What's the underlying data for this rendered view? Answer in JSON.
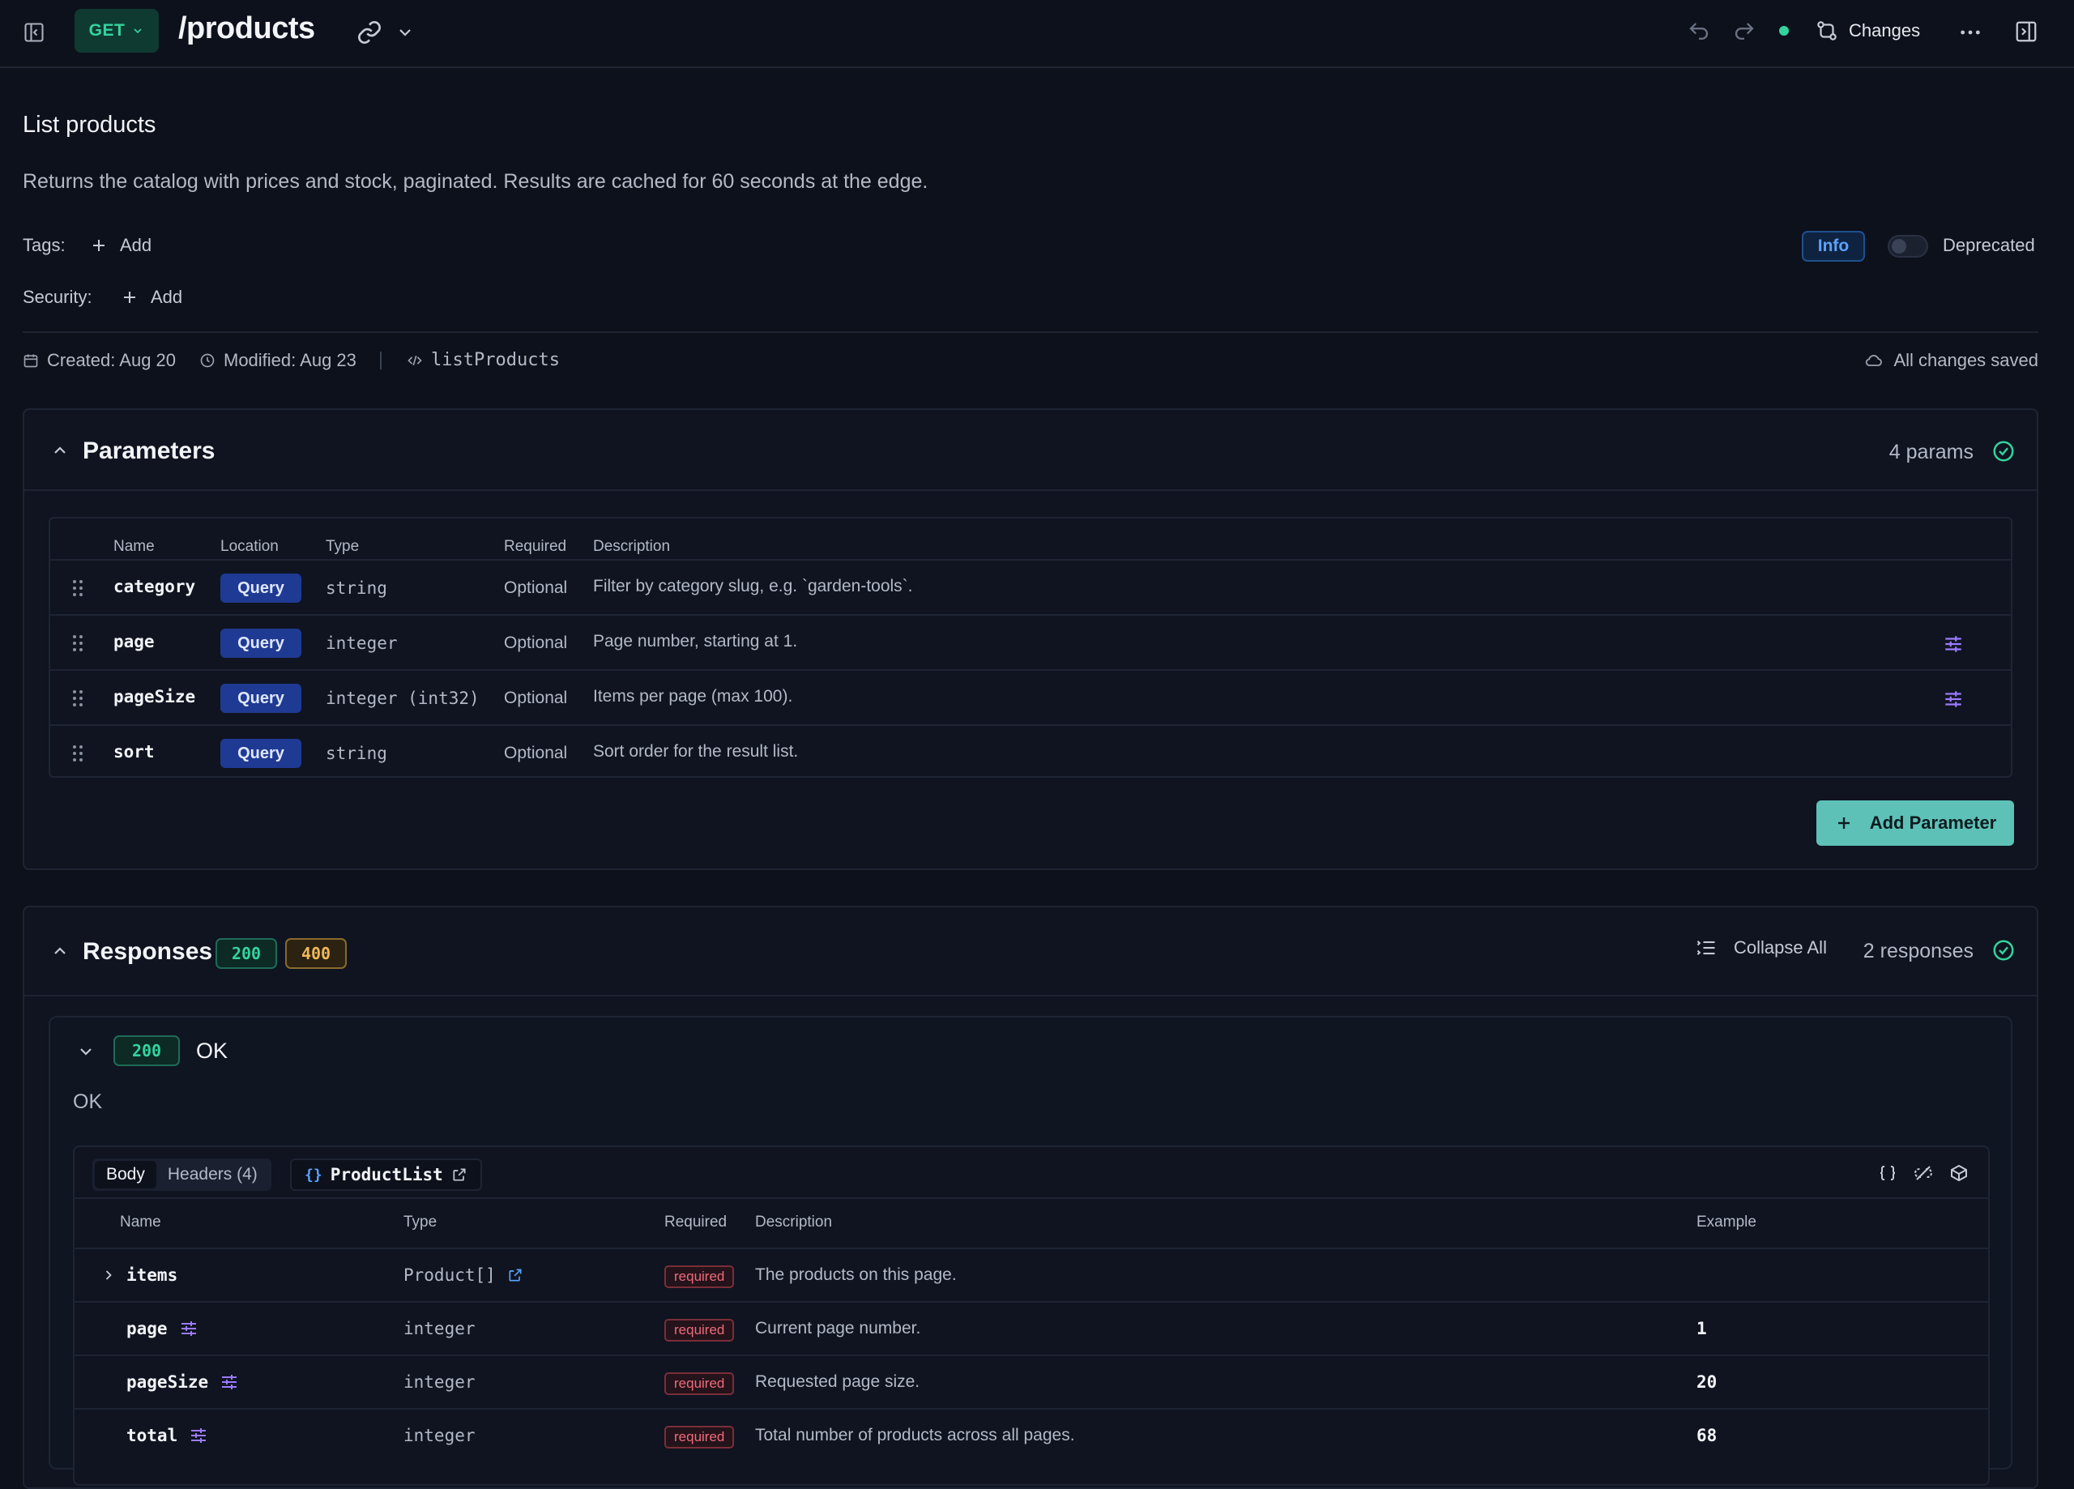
{
  "topbar": {
    "method": "GET",
    "path": "/products",
    "changes_label": "Changes"
  },
  "operation": {
    "summary": "List products",
    "description": "Returns the catalog with prices and stock, paginated. Results are cached for 60 seconds at the edge.",
    "tags_label": "Tags:",
    "security_label": "Security:",
    "add_label": "Add",
    "info_badge": "Info",
    "deprecated_label": "Deprecated",
    "deprecated": false,
    "created": "Created: Aug 20",
    "modified": "Modified: Aug 23",
    "operation_id": "listProducts",
    "saved_status": "All changes saved"
  },
  "parameters": {
    "title": "Parameters",
    "count": "4 params",
    "headers": [
      "Name",
      "Location",
      "Type",
      "Required",
      "Description"
    ],
    "rows": [
      {
        "name": "category",
        "location": "Query",
        "type": "string",
        "required": "Optional",
        "description": "Filter by category slug, e.g. `garden-tools`.",
        "has_constraints": false
      },
      {
        "name": "page",
        "location": "Query",
        "type": "integer",
        "required": "Optional",
        "description": "Page number, starting at 1.",
        "has_constraints": true
      },
      {
        "name": "pageSize",
        "location": "Query",
        "type": "integer (int32)",
        "required": "Optional",
        "description": "Items per page (max 100).",
        "has_constraints": true
      },
      {
        "name": "sort",
        "location": "Query",
        "type": "string",
        "required": "Optional",
        "description": "Sort order for the result list.",
        "has_constraints": false
      }
    ],
    "add_button": "Add Parameter"
  },
  "responses": {
    "title": "Responses",
    "codes": [
      "200",
      "400"
    ],
    "collapse_all": "Collapse All",
    "count": "2 responses",
    "expanded": {
      "code": "200",
      "status": "OK",
      "description": "OK",
      "tabs": [
        "Body",
        "Headers (4)"
      ],
      "active_tab": "Body",
      "schema_brace": "{}",
      "schema_name": "ProductList",
      "headers": [
        "Name",
        "Type",
        "Required",
        "Description",
        "Example"
      ],
      "rows": [
        {
          "name": "items",
          "type": "Product[]",
          "required": "required",
          "description": "The products on this page.",
          "example": ""
        },
        {
          "name": "page",
          "type": "integer",
          "required": "required",
          "description": "Current page number.",
          "example": "1"
        },
        {
          "name": "pageSize",
          "type": "integer",
          "required": "required",
          "description": "Requested page size.",
          "example": "20"
        },
        {
          "name": "total",
          "type": "integer",
          "required": "required",
          "description": "Total number of products across all pages.",
          "example": "68"
        }
      ]
    }
  },
  "colors": {
    "background": "#0d111b",
    "get_method": "#34d39e",
    "query_badge": "#1f3a93",
    "add_parameter": "#5dc1b8",
    "status_200": "#34d39e",
    "status_400": "#f0b956",
    "required_badge": "#ef6b7b",
    "constraint_icon": "#9b7bff"
  }
}
